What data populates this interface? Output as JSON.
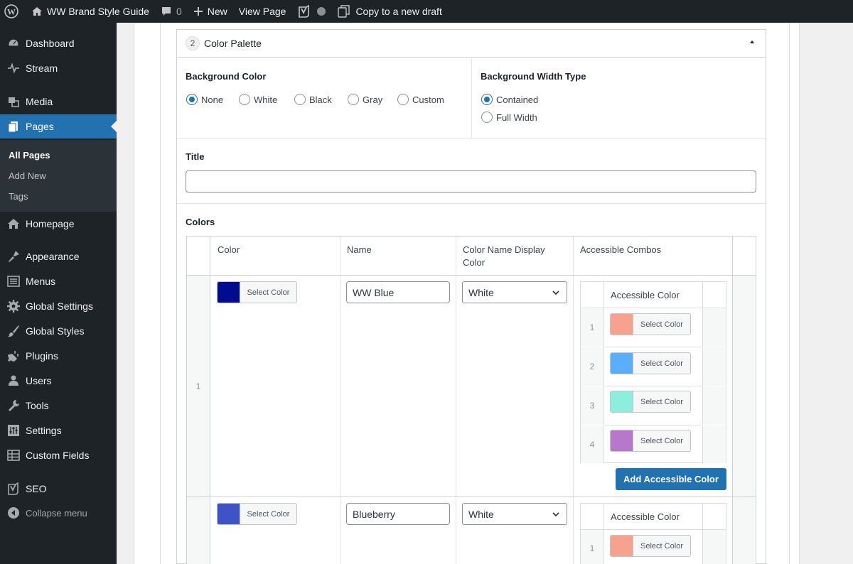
{
  "adminbar": {
    "site_name": "WW Brand Style Guide",
    "comment_count": "0",
    "new_label": "New",
    "view_page_label": "View Page",
    "copy_draft_label": "Copy to a new draft"
  },
  "sidebar": {
    "items": [
      {
        "label": "Dashboard",
        "icon": "dashboard-icon"
      },
      {
        "label": "Stream",
        "icon": "stream-icon"
      },
      {
        "label": "Media",
        "icon": "media-icon"
      },
      {
        "label": "Pages",
        "icon": "pages-icon",
        "current": true
      },
      {
        "label": "Homepage",
        "icon": "home-icon"
      },
      {
        "label": "Appearance",
        "icon": "appearance-icon"
      },
      {
        "label": "Menus",
        "icon": "menus-icon"
      },
      {
        "label": "Global Settings",
        "icon": "gear-icon"
      },
      {
        "label": "Global Styles",
        "icon": "brush-icon"
      },
      {
        "label": "Plugins",
        "icon": "plugins-icon"
      },
      {
        "label": "Users",
        "icon": "users-icon"
      },
      {
        "label": "Tools",
        "icon": "tools-icon"
      },
      {
        "label": "Settings",
        "icon": "settings-icon"
      },
      {
        "label": "Custom Fields",
        "icon": "custom-fields-icon"
      },
      {
        "label": "SEO",
        "icon": "yoast-icon"
      }
    ],
    "submenu": [
      "All Pages",
      "Add New",
      "Tags"
    ],
    "collapse_label": "Collapse menu"
  },
  "panel": {
    "order": "2",
    "title": "Color Palette",
    "background_color": {
      "label": "Background Color",
      "options": [
        "None",
        "White",
        "Black",
        "Gray",
        "Custom"
      ],
      "selected": "None"
    },
    "background_width": {
      "label": "Background Width Type",
      "options": [
        "Contained",
        "Full Width"
      ],
      "selected": "Contained"
    },
    "title_field": {
      "label": "Title",
      "value": ""
    },
    "colors": {
      "label": "Colors",
      "columns": [
        "Color",
        "Name",
        "Color Name Display Color",
        "Accessible Combos"
      ],
      "select_color_label": "Select Color",
      "accessible_color_header": "Accessible Color",
      "add_accessible_label": "Add Accessible Color",
      "rows": [
        {
          "index": "1",
          "color": "#000c8f",
          "name": "WW Blue",
          "display_color": "White",
          "combos": [
            {
              "index": "1",
              "color": "#f7a28e"
            },
            {
              "index": "2",
              "color": "#5aaefb"
            },
            {
              "index": "3",
              "color": "#8eeedd"
            },
            {
              "index": "4",
              "color": "#b778cc"
            }
          ]
        },
        {
          "index": "",
          "color": "#3d53c6",
          "name": "Blueberry",
          "display_color": "White",
          "combos": [
            {
              "index": "1",
              "color": "#f7a28e"
            }
          ]
        }
      ]
    }
  },
  "colors": {
    "admin_dark": "#1d2327",
    "accent": "#2271b1"
  }
}
